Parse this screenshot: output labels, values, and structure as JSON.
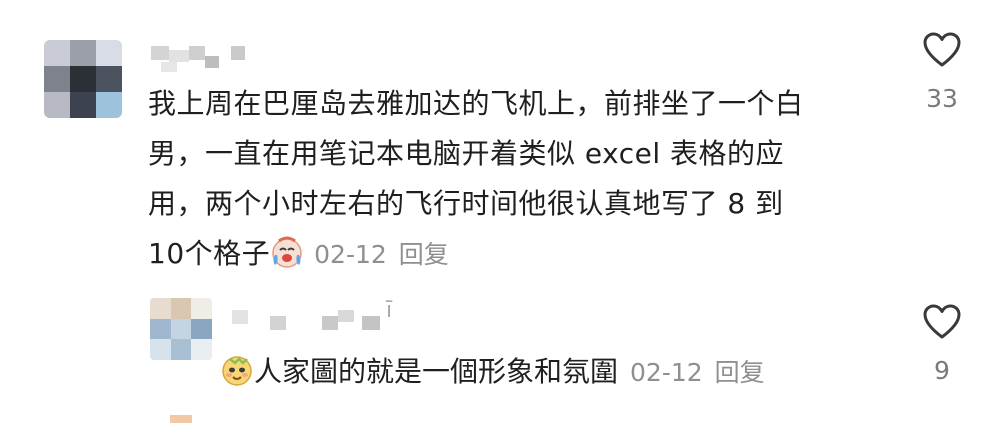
{
  "comment": {
    "username": "",
    "text_lines": [
      "我上周在巴厘岛去雅加达的飞机上，前排坐了一个白",
      "男，一直在用笔记本电脑开着类似 excel 表格的应",
      "用，两个小时左右的飞行时间他很认真地写了 8 到",
      "10个格子"
    ],
    "emoji": "crying-laughing-emoji",
    "date": "02-12",
    "reply_label": "回复",
    "like_count": "33",
    "like_icon": "heart-outline-icon"
  },
  "reply": {
    "username": "",
    "username_glyph": "ī",
    "emoji": "smirking-face-emoji",
    "text": "人家圖的就是一個形象和氛圍",
    "date": "02-12",
    "reply_label": "回复",
    "like_count": "9",
    "like_icon": "heart-outline-icon"
  },
  "colors": {
    "text_primary": "#1f1f1f",
    "text_meta": "#8f8f8f",
    "like_count": "#7a7a7a",
    "icon_stroke": "#3a3a3a"
  }
}
